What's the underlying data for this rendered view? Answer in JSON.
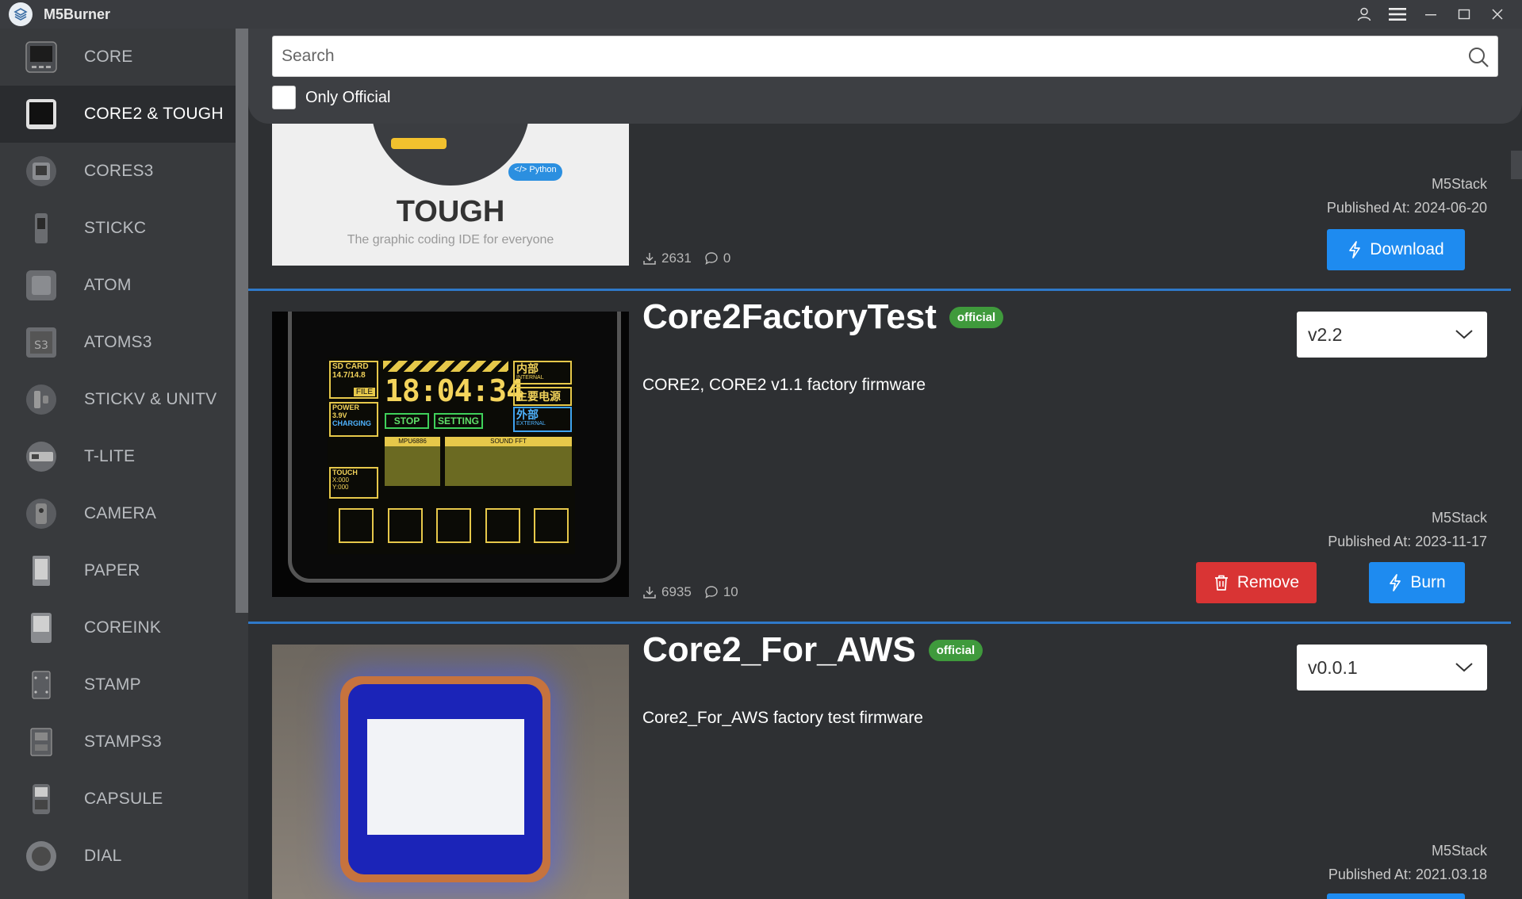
{
  "app": {
    "title": "M5Burner"
  },
  "colors": {
    "accent": "#1e8bf0",
    "danger": "#d93434",
    "official": "#3f9a3c",
    "divider": "#2f79c9"
  },
  "sidebar": {
    "items": [
      {
        "label": "CORE",
        "icon": "core-device-icon"
      },
      {
        "label": "CORE2 & TOUGH",
        "icon": "core2-device-icon",
        "active": true
      },
      {
        "label": "CORES3",
        "icon": "cores3-device-icon"
      },
      {
        "label": "STICKC",
        "icon": "stickc-device-icon"
      },
      {
        "label": "ATOM",
        "icon": "atom-device-icon"
      },
      {
        "label": "ATOMS3",
        "icon": "atoms3-device-icon"
      },
      {
        "label": "STICKV & UNITV",
        "icon": "stickv-device-icon"
      },
      {
        "label": "T-LITE",
        "icon": "tlite-device-icon"
      },
      {
        "label": "CAMERA",
        "icon": "camera-device-icon"
      },
      {
        "label": "PAPER",
        "icon": "paper-device-icon"
      },
      {
        "label": "COREINK",
        "icon": "coreink-device-icon"
      },
      {
        "label": "STAMP",
        "icon": "stamp-device-icon"
      },
      {
        "label": "STAMPS3",
        "icon": "stamps3-device-icon"
      },
      {
        "label": "CAPSULE",
        "icon": "capsule-device-icon"
      },
      {
        "label": "DIAL",
        "icon": "dial-device-icon"
      }
    ]
  },
  "search": {
    "placeholder": "Search",
    "value": "",
    "only_official_label": "Only Official",
    "only_official_checked": false
  },
  "cards": [
    {
      "thumb_title": "TOUGH",
      "thumb_subtitle": "The graphic coding IDE for everyone",
      "thumb_tag": "</> Python",
      "author": "M5Stack",
      "published": "Published At: 2024-06-20",
      "downloads": "2631",
      "comments": "0",
      "download_label": "Download"
    },
    {
      "title": "Core2FactoryTest",
      "badge": "official",
      "description": "CORE2, CORE2 v1.1 factory firmware",
      "version": "v2.2",
      "author": "M5Stack",
      "published": "Published At: 2023-11-17",
      "downloads": "6935",
      "comments": "10",
      "remove_label": "Remove",
      "burn_label": "Burn",
      "screen": {
        "sd": "SD CARD",
        "sd_size": "14.7/14.8",
        "file": "FILE",
        "time": "18:04:34",
        "internal_cn": "内部",
        "internal": "INTERNAL",
        "main_power_cn": "主要电源",
        "external_cn": "外部",
        "external": "EXTERNAL",
        "power": "POWER",
        "voltage": "3.9V",
        "charging": "CHARGING",
        "stop": "STOP",
        "setting": "SETTING",
        "mpu": "MPU6886",
        "sound": "SOUND FFT",
        "touch": "TOUCH",
        "x": "X:000",
        "y": "Y:000"
      }
    },
    {
      "title": "Core2_For_AWS",
      "badge": "official",
      "description": "Core2_For_AWS factory test firmware",
      "version": "v0.0.1",
      "author": "M5Stack",
      "published": "Published At: 2021.03.18"
    }
  ]
}
